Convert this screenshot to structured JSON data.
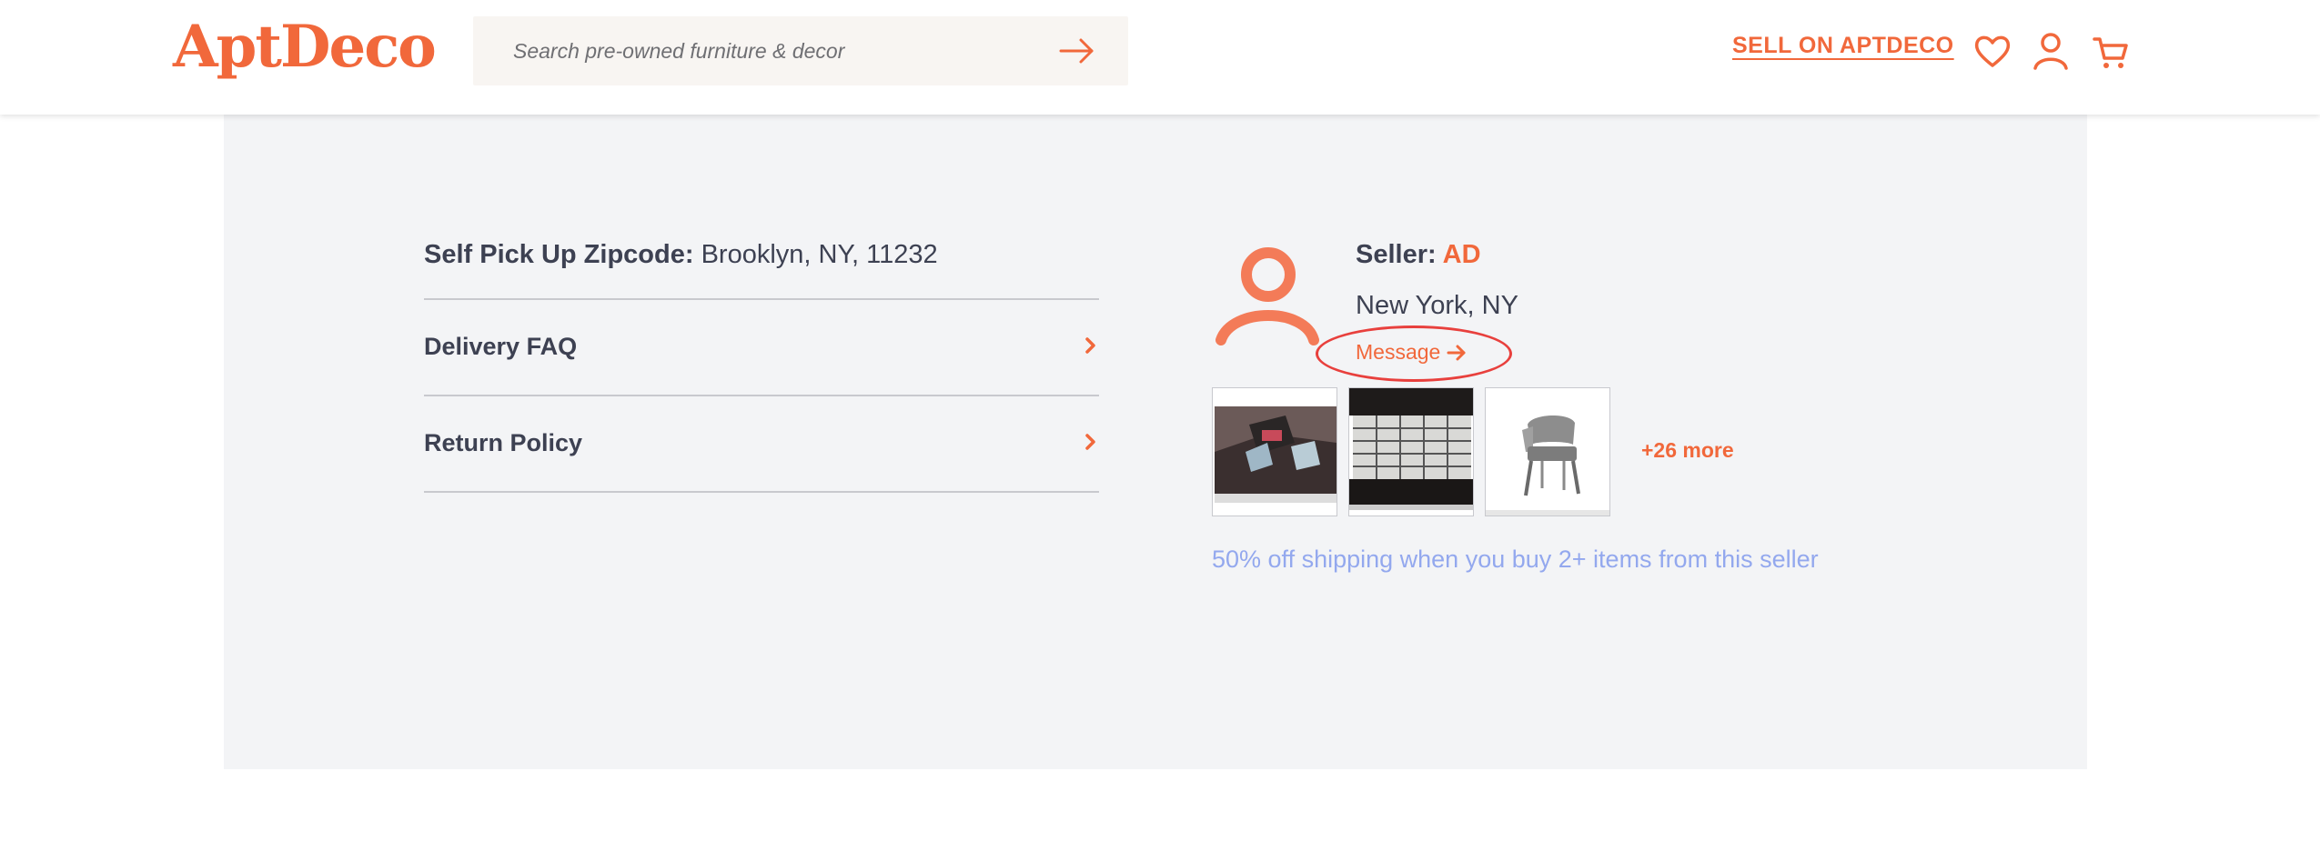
{
  "header": {
    "logo_text": "AptDeco",
    "search_placeholder": "Search pre-owned furniture & decor",
    "sell_label": "SELL ON APTDECO",
    "icons": [
      "heart-icon",
      "user-icon",
      "cart-icon"
    ]
  },
  "delivery": {
    "zip_label": "Self Pick Up Zipcode:",
    "zip_value": "Brooklyn, NY, 11232",
    "rows": [
      {
        "label": "Delivery FAQ"
      },
      {
        "label": "Return Policy"
      }
    ]
  },
  "seller": {
    "label": "Seller:",
    "name": "AD",
    "location": "New York, NY",
    "message_label": "Message",
    "more_label": "+26 more",
    "promo": "50% off shipping when you buy 2+ items from this seller"
  },
  "colors": {
    "brand": "#f1683b",
    "panel_bg": "#f3f4f6",
    "text": "#3d4152",
    "promo": "#93a8ee",
    "highlight_circle": "#e8403d"
  }
}
